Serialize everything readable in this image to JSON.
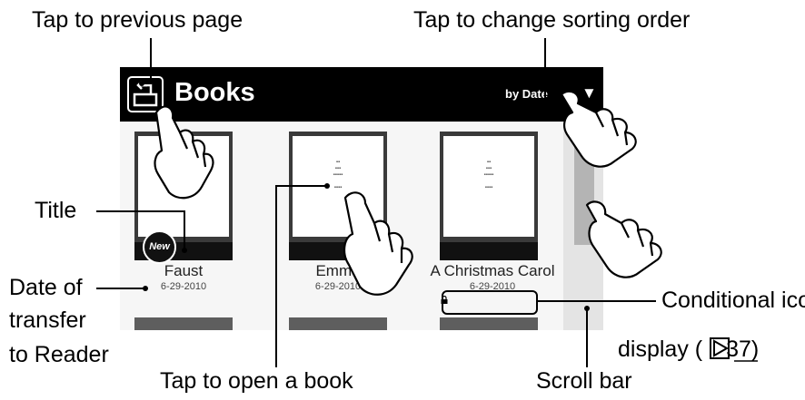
{
  "callouts": {
    "previous_page": "Tap to previous page",
    "sorting_order": "Tap to change sorting order",
    "title": "Title",
    "date_line1": "Date of",
    "date_line2": "transfer",
    "date_line3": "to Reader",
    "open_book": "Tap to open a book",
    "conditional_line1": "Conditional icon",
    "conditional_line2_prefix": "display (",
    "conditional_ref": "37",
    "conditional_line2_suffix": ")",
    "scroll_bar": "Scroll bar"
  },
  "screen": {
    "title": "Books",
    "sort_label": "by Date",
    "badge": "New",
    "books": [
      {
        "title": "Faust",
        "date": "6-29-2010"
      },
      {
        "title": "Emma",
        "date": "6-29-2010"
      },
      {
        "title": "A Christmas Carol",
        "date": "6-29-2010"
      }
    ]
  },
  "icons": [
    "back-arrow-icon",
    "dropdown-triangle-icon",
    "lock-icon",
    "new-badge-icon",
    "hand-pointer-icon",
    "page-reference-icon"
  ]
}
